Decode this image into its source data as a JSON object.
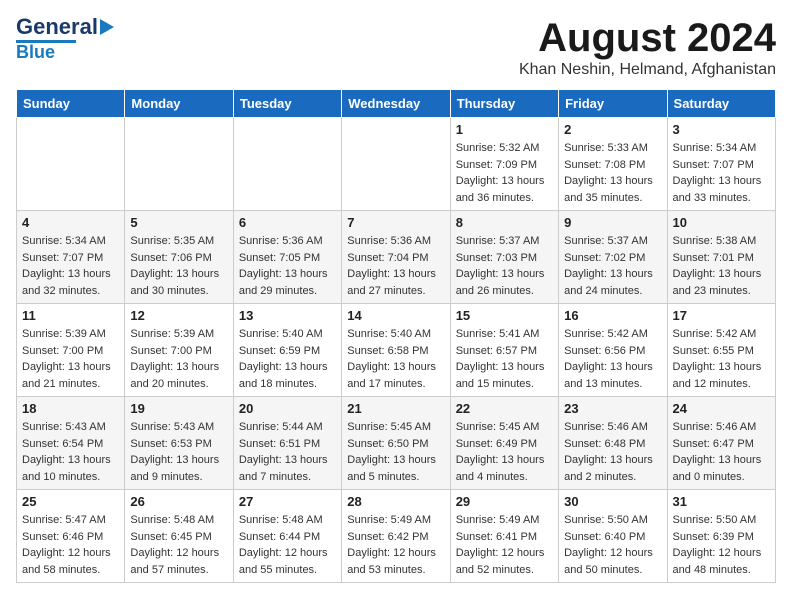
{
  "header": {
    "logo_general": "General",
    "logo_blue": "Blue",
    "month_title": "August 2024",
    "location": "Khan Neshin, Helmand, Afghanistan"
  },
  "weekdays": [
    "Sunday",
    "Monday",
    "Tuesday",
    "Wednesday",
    "Thursday",
    "Friday",
    "Saturday"
  ],
  "weeks": [
    [
      {
        "day": "",
        "sunrise": "",
        "sunset": "",
        "daylight": ""
      },
      {
        "day": "",
        "sunrise": "",
        "sunset": "",
        "daylight": ""
      },
      {
        "day": "",
        "sunrise": "",
        "sunset": "",
        "daylight": ""
      },
      {
        "day": "",
        "sunrise": "",
        "sunset": "",
        "daylight": ""
      },
      {
        "day": "1",
        "sunrise": "Sunrise: 5:32 AM",
        "sunset": "Sunset: 7:09 PM",
        "daylight": "Daylight: 13 hours and 36 minutes."
      },
      {
        "day": "2",
        "sunrise": "Sunrise: 5:33 AM",
        "sunset": "Sunset: 7:08 PM",
        "daylight": "Daylight: 13 hours and 35 minutes."
      },
      {
        "day": "3",
        "sunrise": "Sunrise: 5:34 AM",
        "sunset": "Sunset: 7:07 PM",
        "daylight": "Daylight: 13 hours and 33 minutes."
      }
    ],
    [
      {
        "day": "4",
        "sunrise": "Sunrise: 5:34 AM",
        "sunset": "Sunset: 7:07 PM",
        "daylight": "Daylight: 13 hours and 32 minutes."
      },
      {
        "day": "5",
        "sunrise": "Sunrise: 5:35 AM",
        "sunset": "Sunset: 7:06 PM",
        "daylight": "Daylight: 13 hours and 30 minutes."
      },
      {
        "day": "6",
        "sunrise": "Sunrise: 5:36 AM",
        "sunset": "Sunset: 7:05 PM",
        "daylight": "Daylight: 13 hours and 29 minutes."
      },
      {
        "day": "7",
        "sunrise": "Sunrise: 5:36 AM",
        "sunset": "Sunset: 7:04 PM",
        "daylight": "Daylight: 13 hours and 27 minutes."
      },
      {
        "day": "8",
        "sunrise": "Sunrise: 5:37 AM",
        "sunset": "Sunset: 7:03 PM",
        "daylight": "Daylight: 13 hours and 26 minutes."
      },
      {
        "day": "9",
        "sunrise": "Sunrise: 5:37 AM",
        "sunset": "Sunset: 7:02 PM",
        "daylight": "Daylight: 13 hours and 24 minutes."
      },
      {
        "day": "10",
        "sunrise": "Sunrise: 5:38 AM",
        "sunset": "Sunset: 7:01 PM",
        "daylight": "Daylight: 13 hours and 23 minutes."
      }
    ],
    [
      {
        "day": "11",
        "sunrise": "Sunrise: 5:39 AM",
        "sunset": "Sunset: 7:00 PM",
        "daylight": "Daylight: 13 hours and 21 minutes."
      },
      {
        "day": "12",
        "sunrise": "Sunrise: 5:39 AM",
        "sunset": "Sunset: 7:00 PM",
        "daylight": "Daylight: 13 hours and 20 minutes."
      },
      {
        "day": "13",
        "sunrise": "Sunrise: 5:40 AM",
        "sunset": "Sunset: 6:59 PM",
        "daylight": "Daylight: 13 hours and 18 minutes."
      },
      {
        "day": "14",
        "sunrise": "Sunrise: 5:40 AM",
        "sunset": "Sunset: 6:58 PM",
        "daylight": "Daylight: 13 hours and 17 minutes."
      },
      {
        "day": "15",
        "sunrise": "Sunrise: 5:41 AM",
        "sunset": "Sunset: 6:57 PM",
        "daylight": "Daylight: 13 hours and 15 minutes."
      },
      {
        "day": "16",
        "sunrise": "Sunrise: 5:42 AM",
        "sunset": "Sunset: 6:56 PM",
        "daylight": "Daylight: 13 hours and 13 minutes."
      },
      {
        "day": "17",
        "sunrise": "Sunrise: 5:42 AM",
        "sunset": "Sunset: 6:55 PM",
        "daylight": "Daylight: 13 hours and 12 minutes."
      }
    ],
    [
      {
        "day": "18",
        "sunrise": "Sunrise: 5:43 AM",
        "sunset": "Sunset: 6:54 PM",
        "daylight": "Daylight: 13 hours and 10 minutes."
      },
      {
        "day": "19",
        "sunrise": "Sunrise: 5:43 AM",
        "sunset": "Sunset: 6:53 PM",
        "daylight": "Daylight: 13 hours and 9 minutes."
      },
      {
        "day": "20",
        "sunrise": "Sunrise: 5:44 AM",
        "sunset": "Sunset: 6:51 PM",
        "daylight": "Daylight: 13 hours and 7 minutes."
      },
      {
        "day": "21",
        "sunrise": "Sunrise: 5:45 AM",
        "sunset": "Sunset: 6:50 PM",
        "daylight": "Daylight: 13 hours and 5 minutes."
      },
      {
        "day": "22",
        "sunrise": "Sunrise: 5:45 AM",
        "sunset": "Sunset: 6:49 PM",
        "daylight": "Daylight: 13 hours and 4 minutes."
      },
      {
        "day": "23",
        "sunrise": "Sunrise: 5:46 AM",
        "sunset": "Sunset: 6:48 PM",
        "daylight": "Daylight: 13 hours and 2 minutes."
      },
      {
        "day": "24",
        "sunrise": "Sunrise: 5:46 AM",
        "sunset": "Sunset: 6:47 PM",
        "daylight": "Daylight: 13 hours and 0 minutes."
      }
    ],
    [
      {
        "day": "25",
        "sunrise": "Sunrise: 5:47 AM",
        "sunset": "Sunset: 6:46 PM",
        "daylight": "Daylight: 12 hours and 58 minutes."
      },
      {
        "day": "26",
        "sunrise": "Sunrise: 5:48 AM",
        "sunset": "Sunset: 6:45 PM",
        "daylight": "Daylight: 12 hours and 57 minutes."
      },
      {
        "day": "27",
        "sunrise": "Sunrise: 5:48 AM",
        "sunset": "Sunset: 6:44 PM",
        "daylight": "Daylight: 12 hours and 55 minutes."
      },
      {
        "day": "28",
        "sunrise": "Sunrise: 5:49 AM",
        "sunset": "Sunset: 6:42 PM",
        "daylight": "Daylight: 12 hours and 53 minutes."
      },
      {
        "day": "29",
        "sunrise": "Sunrise: 5:49 AM",
        "sunset": "Sunset: 6:41 PM",
        "daylight": "Daylight: 12 hours and 52 minutes."
      },
      {
        "day": "30",
        "sunrise": "Sunrise: 5:50 AM",
        "sunset": "Sunset: 6:40 PM",
        "daylight": "Daylight: 12 hours and 50 minutes."
      },
      {
        "day": "31",
        "sunrise": "Sunrise: 5:50 AM",
        "sunset": "Sunset: 6:39 PM",
        "daylight": "Daylight: 12 hours and 48 minutes."
      }
    ]
  ]
}
